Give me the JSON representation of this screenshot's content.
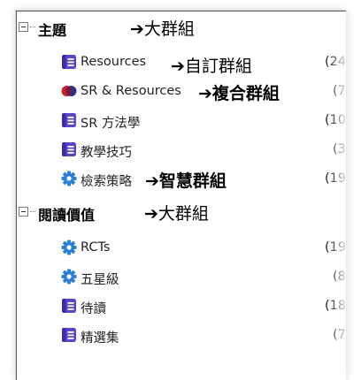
{
  "groups": [
    {
      "label": "主題",
      "annotation": "➔大群組",
      "items": [
        {
          "label": "Resources",
          "icon": "notebook-icon",
          "count": "(24",
          "annotation": "➔自訂群組"
        },
        {
          "label": "SR & Resources",
          "icon": "composite-group-icon",
          "count": "(7",
          "annotation": "➔複合群組"
        },
        {
          "label": "SR 方法學",
          "icon": "notebook-icon",
          "count": "(10"
        },
        {
          "label": "教學技巧",
          "icon": "notebook-icon",
          "count": "(3"
        },
        {
          "label": "檢索策略",
          "icon": "smart-group-gear-icon",
          "count": "(19",
          "annotation": "➔智慧群組"
        }
      ]
    },
    {
      "label": "閱讀價值",
      "annotation": "➔大群組",
      "items": [
        {
          "label": "RCTs",
          "icon": "smart-group-gear-icon",
          "count": "(19"
        },
        {
          "label": "五星級",
          "icon": "smart-group-gear-icon",
          "count": "(8"
        },
        {
          "label": "待讀",
          "icon": "notebook-icon",
          "count": "(18"
        },
        {
          "label": "精選集",
          "icon": "notebook-icon",
          "count": "(7"
        }
      ]
    }
  ],
  "colors": {
    "notebook_icon": "#5a44c8",
    "gear_icon": "#2b7fd6",
    "composite_blue": "#24348e",
    "composite_red": "#cc1f24",
    "tree_lines": "#7a7a7a"
  }
}
